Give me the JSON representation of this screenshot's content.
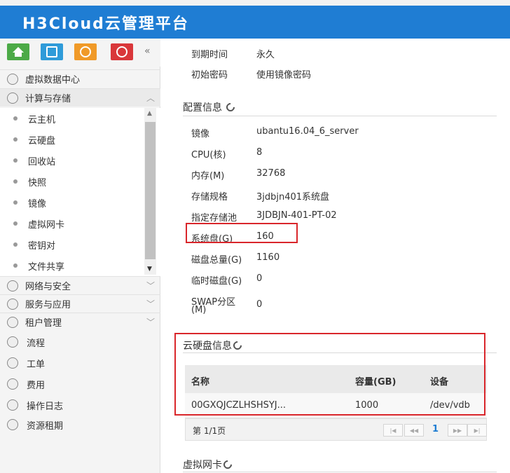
{
  "header": {
    "title": "H3Cloud云管理平台"
  },
  "quickbar": {
    "buttons": [
      {
        "icon": "home-icon",
        "color": "#4caa47"
      },
      {
        "icon": "monitor-icon",
        "color": "#2f9bd9"
      },
      {
        "icon": "user-icon",
        "color": "#f09a28"
      },
      {
        "icon": "stack-icon",
        "color": "#d9373a"
      }
    ],
    "collapse": "«"
  },
  "sidebar": {
    "groups": [
      {
        "label": "虚拟数据中心"
      },
      {
        "label": "计算与存储",
        "chevron": "^"
      },
      {
        "label": "网络与安全",
        "chevron": "v"
      },
      {
        "label": "服务与应用",
        "chevron": "v"
      },
      {
        "label": "租户管理",
        "chevron": "v"
      }
    ],
    "compute_items": [
      "云主机",
      "云硬盘",
      "回收站",
      "快照",
      "镜像",
      "虚拟网卡",
      "密钥对",
      "文件共享"
    ],
    "plain_items": [
      "流程",
      "工单",
      "费用",
      "操作日志",
      "资源租期"
    ]
  },
  "main": {
    "top_info": [
      {
        "label": "到期时间",
        "value": "永久"
      },
      {
        "label": "初始密码",
        "value": "使用镜像密码"
      }
    ],
    "config_title": "配置信息",
    "config": [
      {
        "label": "镜像",
        "value": "ubantu16.04_6_server"
      },
      {
        "label": "CPU(核)",
        "value": "8"
      },
      {
        "label": "内存(M)",
        "value": "32768"
      },
      {
        "label": "存储规格",
        "value": "3jdbjn401系统盘"
      },
      {
        "label": "指定存储池",
        "value": "3JDBJN-401-PT-02"
      },
      {
        "label": "系统盘(G)",
        "value": "160"
      },
      {
        "label": "磁盘总量(G)",
        "value": "1160"
      },
      {
        "label": "临时磁盘(G)",
        "value": "0"
      },
      {
        "label": "SWAP分区",
        "label2": "(M)",
        "value": "0"
      }
    ],
    "disk_title": "云硬盘信息",
    "disk_table": {
      "headers": [
        "名称",
        "容量(GB)",
        "设备"
      ],
      "rows": [
        [
          "00GXQJCZLHSHSYJ...",
          "1000",
          "/dev/vdb"
        ]
      ],
      "page_text": "第 1/1页",
      "current_page": "1"
    },
    "nic_title": "虚拟网卡"
  }
}
